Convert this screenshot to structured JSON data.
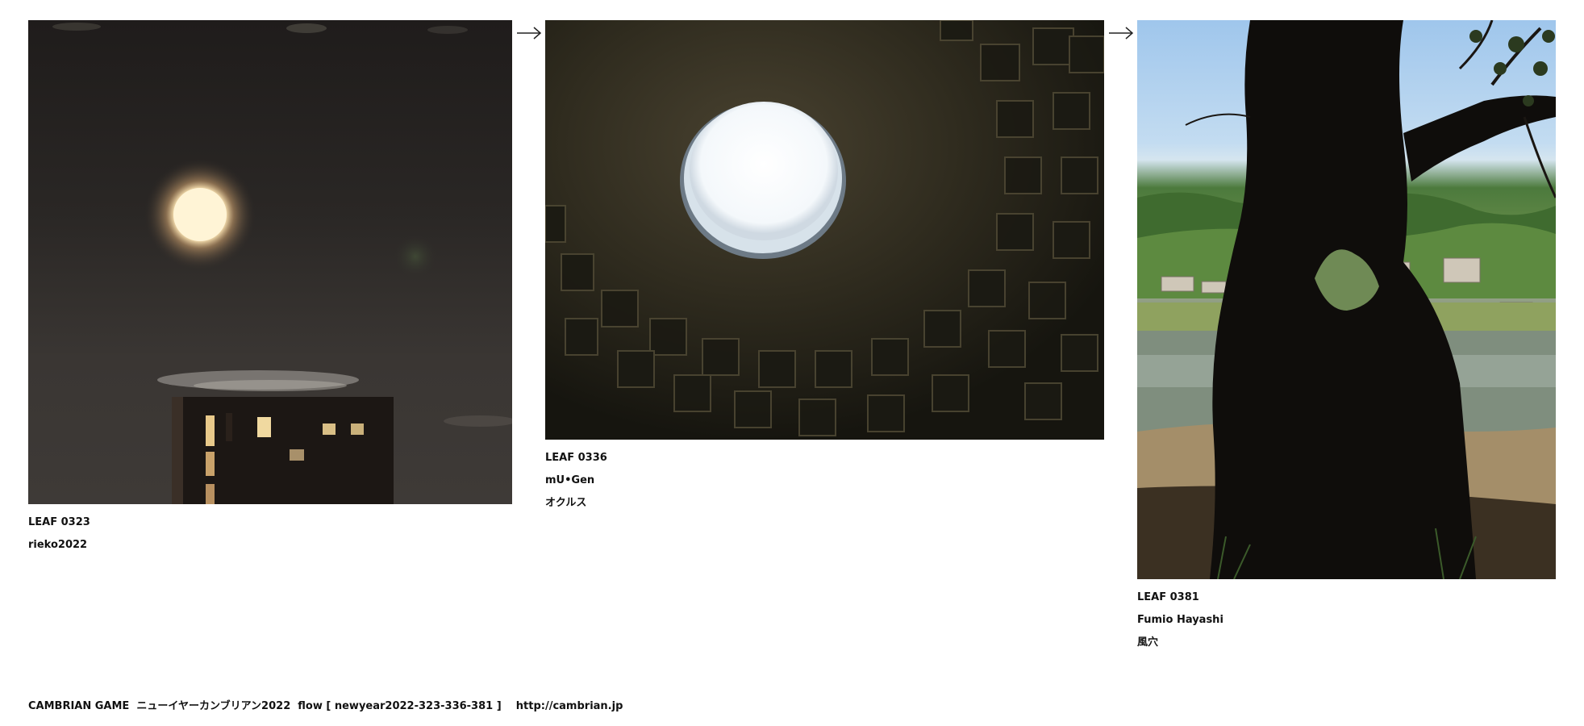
{
  "leaves": [
    {
      "id": "LEAF 0323",
      "author": "rieko2022",
      "title": ""
    },
    {
      "id": "LEAF 0336",
      "author": "mU•Gen",
      "title": "オクルス"
    },
    {
      "id": "LEAF 0381",
      "author": "Fumio Hayashi",
      "title": "風穴"
    }
  ],
  "arrow_icon": "right-arrow-icon",
  "footer": {
    "text": "CAMBRIAN GAME  ニューイヤーカンブリアン2022  flow [ newyear2022-323-336-381 ]    http://cambrian.jp"
  },
  "colors": {
    "background": "#ffffff",
    "text": "#111111"
  }
}
